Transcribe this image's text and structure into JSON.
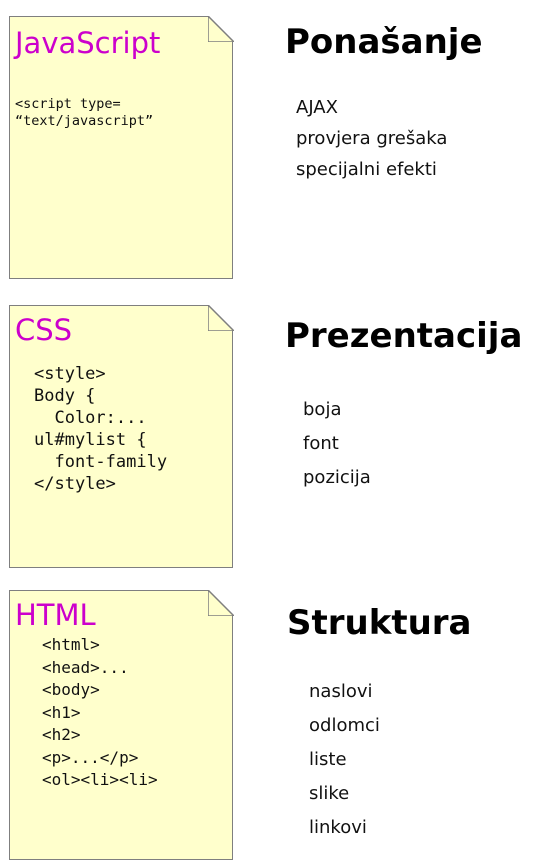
{
  "layers": [
    {
      "id": "javascript",
      "note": {
        "title": "JavaScript",
        "code": [
          "<script type=",
          "“text/javascript”"
        ]
      },
      "heading": "Ponašanje",
      "items": [
        "AJAX",
        "provjera grešaka",
        "specijalni efekti"
      ]
    },
    {
      "id": "css",
      "note": {
        "title": "CSS",
        "code": [
          "<style>",
          "Body {",
          "  Color:...",
          "ul#mylist {",
          "  font-family",
          "</style>"
        ]
      },
      "heading": "Prezentacija",
      "items": [
        "boja",
        "font",
        "pozicija"
      ]
    },
    {
      "id": "html",
      "note": {
        "title": "HTML",
        "code": [
          "<html>",
          "<head>...",
          "<body>",
          "<h1>",
          "<h2>",
          "<p>...</p>",
          "<ol><li><li>"
        ]
      },
      "heading": "Struktura",
      "items": [
        "naslovi",
        "odlomci",
        "liste",
        "slike",
        "linkovi"
      ]
    }
  ],
  "colors": {
    "note_fill": "#ffffcc",
    "note_border": "#7f7f7f",
    "note_title": "#cc00cc",
    "text": "#000000"
  }
}
